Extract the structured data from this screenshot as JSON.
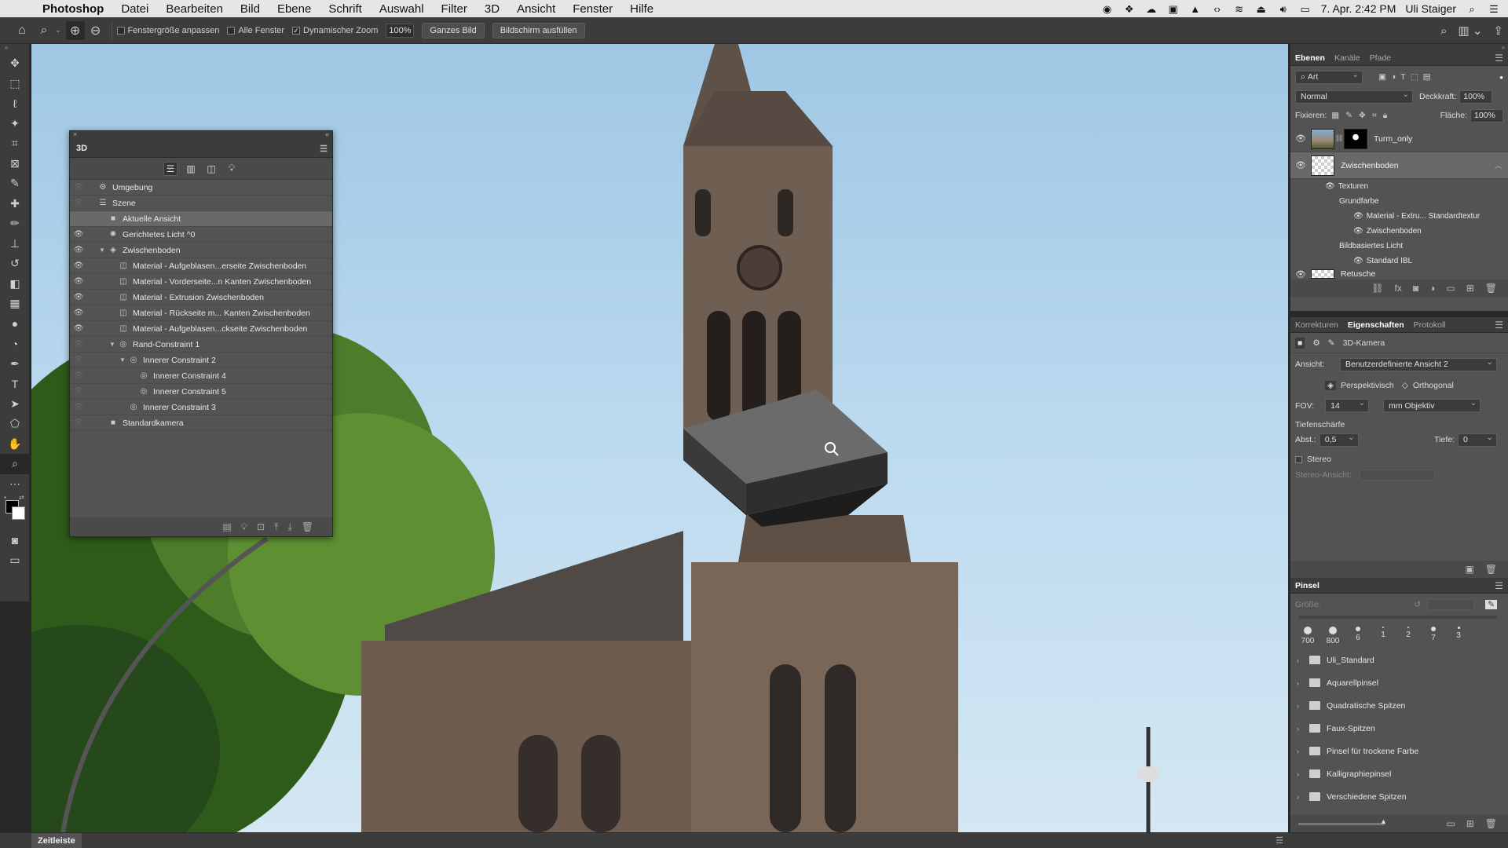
{
  "menubar": {
    "app_name": "Photoshop",
    "items": [
      "Datei",
      "Bearbeiten",
      "Bild",
      "Ebene",
      "Schrift",
      "Auswahl",
      "Filter",
      "3D",
      "Ansicht",
      "Fenster",
      "Hilfe"
    ],
    "datetime": "7. Apr.  2:42 PM",
    "user": "Uli Staiger"
  },
  "options": {
    "fit_window": "Fenstergröße anpassen",
    "all_windows": "Alle Fenster",
    "scrubby_zoom": "Dynamischer Zoom",
    "zoom_value": "100%",
    "fit_screen": "Ganzes Bild",
    "fill_screen": "Bildschirm ausfüllen"
  },
  "panel3d": {
    "title": "3D",
    "rows": [
      {
        "label": "Umgebung",
        "indent": 0,
        "eye": "off",
        "caret": "",
        "icon": "env"
      },
      {
        "label": "Szene",
        "indent": 0,
        "eye": "off",
        "caret": "",
        "icon": "scene"
      },
      {
        "label": "Aktuelle Ansicht",
        "indent": 1,
        "eye": "off",
        "caret": "",
        "icon": "camera",
        "selected": true
      },
      {
        "label": "Gerichtetes Licht ^0",
        "indent": 1,
        "eye": "on",
        "caret": "",
        "icon": "light"
      },
      {
        "label": "Zwischenboden",
        "indent": 1,
        "eye": "on",
        "caret": "open",
        "icon": "mesh"
      },
      {
        "label": "Material - Aufgeblasen...erseite Zwischenboden",
        "indent": 2,
        "eye": "on",
        "caret": "",
        "icon": "material"
      },
      {
        "label": "Material - Vorderseite...n Kanten Zwischenboden",
        "indent": 2,
        "eye": "on",
        "caret": "",
        "icon": "material"
      },
      {
        "label": "Material - Extrusion Zwischenboden",
        "indent": 2,
        "eye": "on",
        "caret": "",
        "icon": "material"
      },
      {
        "label": "Material - Rückseite m... Kanten Zwischenboden",
        "indent": 2,
        "eye": "on",
        "caret": "",
        "icon": "material"
      },
      {
        "label": "Material - Aufgeblasen...ckseite Zwischenboden",
        "indent": 2,
        "eye": "on",
        "caret": "",
        "icon": "material"
      },
      {
        "label": "Rand-Constraint 1",
        "indent": 2,
        "eye": "off",
        "caret": "open",
        "icon": "constraint"
      },
      {
        "label": "Innerer Constraint 2",
        "indent": 3,
        "eye": "off",
        "caret": "open",
        "icon": "constraint"
      },
      {
        "label": "Innerer Constraint 4",
        "indent": 4,
        "eye": "off",
        "caret": "",
        "icon": "constraint"
      },
      {
        "label": "Innerer Constraint 5",
        "indent": 4,
        "eye": "off",
        "caret": "",
        "icon": "constraint"
      },
      {
        "label": "Innerer Constraint 3",
        "indent": 3,
        "eye": "off",
        "caret": "",
        "icon": "constraint"
      },
      {
        "label": "Standardkamera",
        "indent": 1,
        "eye": "off",
        "caret": "",
        "icon": "camera"
      }
    ]
  },
  "layers_panel": {
    "tabs": [
      "Ebenen",
      "Kanäle",
      "Pfade"
    ],
    "filter": "Art",
    "blend_mode": "Normal",
    "opacity_label": "Deckkraft:",
    "opacity": "100%",
    "lock_label": "Fixieren:",
    "fill_label": "Fläche:",
    "fill": "100%",
    "layers": [
      {
        "name": "Turm_only",
        "thumb": "photo",
        "mask": true
      },
      {
        "name": "Zwischenboden",
        "thumb": "checker",
        "mask": false,
        "active": true
      }
    ],
    "sub_items": [
      {
        "label": "Texturen",
        "indent": 1,
        "eye": true
      },
      {
        "label": "Grundfarbe",
        "indent": 2,
        "eye": false
      },
      {
        "label": "Material - Extru... Standardtextur",
        "indent": 3,
        "eye": true
      },
      {
        "label": "Zwischenboden",
        "indent": 3,
        "eye": true
      },
      {
        "label": "Bildbasiertes Licht",
        "indent": 2,
        "eye": false
      },
      {
        "label": "Standard IBL",
        "indent": 3,
        "eye": true
      }
    ],
    "partial_layer": "Retusche"
  },
  "properties_panel": {
    "tabs": [
      "Korrekturen",
      "Eigenschaften",
      "Protokoll"
    ],
    "header": "3D-Kamera",
    "view_label": "Ansicht:",
    "view_value": "Benutzerdefinierte Ansicht 2",
    "perspective": "Perspektivisch",
    "orthographic": "Orthogonal",
    "fov_label": "FOV:",
    "fov_value": "14",
    "fov_unit": "mm Objektiv",
    "dof_label": "Tiefenschärfe",
    "dist_label": "Abst.:",
    "dist_value": "0,5",
    "depth_label": "Tiefe:",
    "depth_value": "0",
    "stereo_label": "Stereo",
    "stereo_view_label": "Stereo-Ansicht:"
  },
  "brush_panel": {
    "title": "Pinsel",
    "size_label": "Größe:",
    "sizes": [
      "700",
      "800",
      "6",
      "1",
      "2",
      "7",
      "3"
    ],
    "folders": [
      "Uli_Standard",
      "Aquarellpinsel",
      "Quadratische Spitzen",
      "Faux-Spitzen",
      "Pinsel für trockene Farbe",
      "Kalligraphiepinsel",
      "Verschiedene Spitzen"
    ]
  },
  "timeline": {
    "label": "Zeitleiste"
  }
}
